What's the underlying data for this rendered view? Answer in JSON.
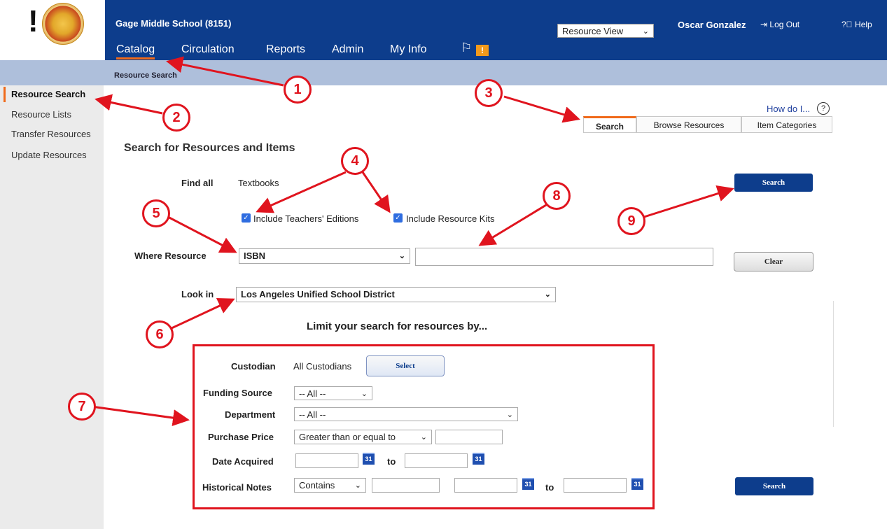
{
  "header": {
    "school": "Gage Middle School (8151)",
    "nav": [
      "Catalog",
      "Circulation",
      "Reports",
      "Admin",
      "My Info"
    ],
    "flag_badge": "!",
    "view_select": "Resource View",
    "user": "Oscar Gonzalez",
    "logout": "Log Out",
    "help": "Help"
  },
  "breadcrumb": "Resource Search",
  "sidebar": {
    "items": [
      "Resource Search",
      "Resource Lists",
      "Transfer Resources",
      "Update Resources"
    ]
  },
  "help_link": "How do I...",
  "tabs": [
    "Search",
    "Browse Resources",
    "Item Categories"
  ],
  "form": {
    "heading": "Search for Resources and Items",
    "find_all_label": "Find all",
    "find_all_value": "Textbooks",
    "include_teachers": "Include Teachers' Editions",
    "include_kits": "Include Resource Kits",
    "where_label": "Where Resource",
    "where_value": "ISBN",
    "lookin_label": "Look in",
    "lookin_value": "Los Angeles Unified School District",
    "search_button": "Search",
    "clear_button": "Clear",
    "limit_heading": "Limit your search for resources by..."
  },
  "limit": {
    "custodian_label": "Custodian",
    "custodian_value": "All Custodians",
    "select_button": "Select",
    "funding_label": "Funding Source",
    "funding_value": "-- All --",
    "department_label": "Department",
    "department_value": "-- All --",
    "price_label": "Purchase Price",
    "price_value": "Greater than or equal to",
    "date_label": "Date Acquired",
    "to": "to",
    "calendar": "31",
    "notes_label": "Historical Notes",
    "notes_value": "Contains"
  },
  "annotations": [
    "1",
    "2",
    "3",
    "4",
    "5",
    "6",
    "7",
    "8",
    "9"
  ],
  "colors": {
    "header": "#0d3d8c",
    "accent": "#f06a1b",
    "annotation": "#e0141e"
  }
}
